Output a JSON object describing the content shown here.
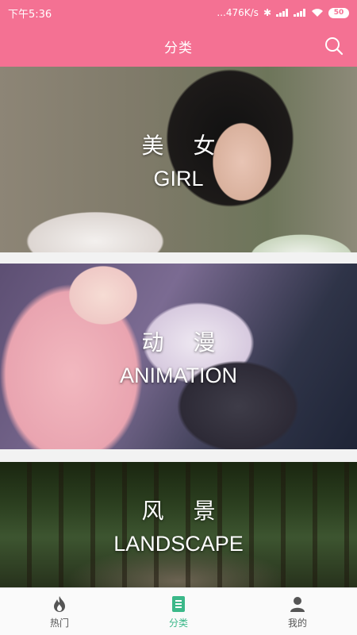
{
  "status_bar": {
    "time": "下午5:36",
    "network_speed": "...476K/s",
    "battery": "50"
  },
  "app_bar": {
    "title": "分类",
    "search_icon": "search-icon"
  },
  "categories": [
    {
      "cn": "美 女",
      "en": "GIRL"
    },
    {
      "cn": "动 漫",
      "en": "ANIMATION"
    },
    {
      "cn": "风 景",
      "en": "LANDSCAPE"
    }
  ],
  "bottom_nav": {
    "items": [
      {
        "label": "热门",
        "icon": "fire-icon"
      },
      {
        "label": "分类",
        "icon": "list-icon",
        "active": true
      },
      {
        "label": "我的",
        "icon": "user-icon"
      }
    ]
  },
  "colors": {
    "primary": "#f47193",
    "active_nav": "#3bb889",
    "inactive_nav": "#555555"
  }
}
